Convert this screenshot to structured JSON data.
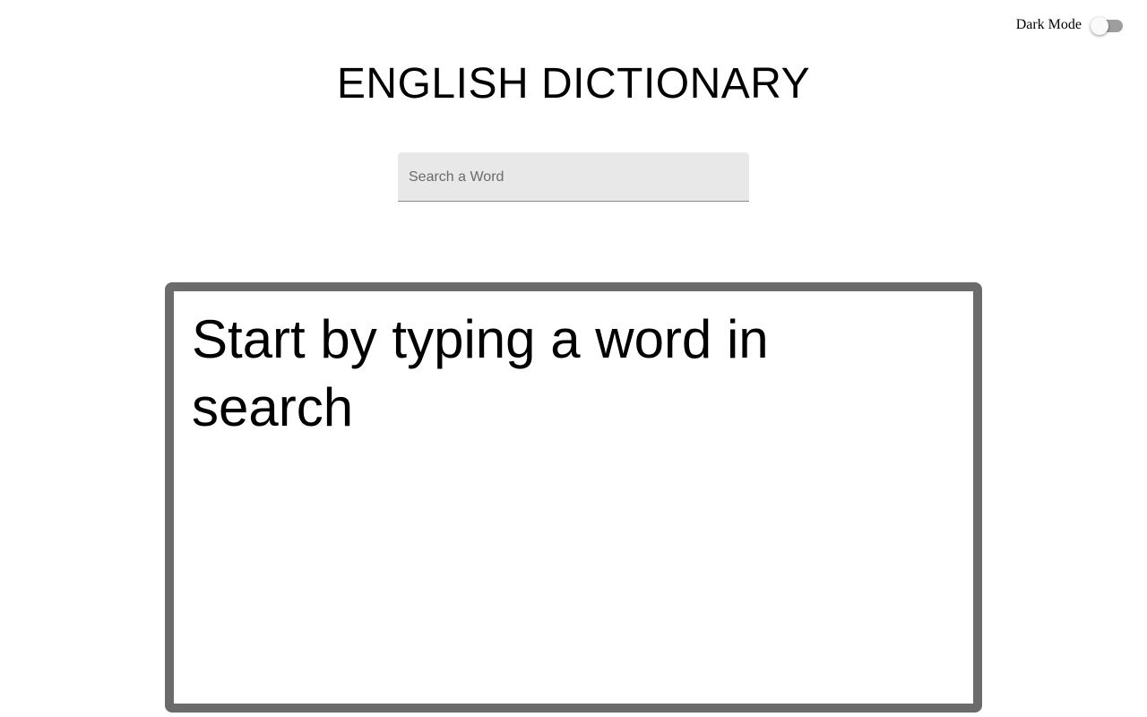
{
  "header": {
    "dark_mode_label": "Dark Mode",
    "dark_mode_enabled": false,
    "title": "ENGLISH DICTIONARY"
  },
  "search": {
    "placeholder": "Search a Word",
    "value": ""
  },
  "result": {
    "message": "Start by typing a word in search"
  },
  "colors": {
    "background": "#ffffff",
    "search_field_bg": "#e8e8e8",
    "result_border": "#6b6b6b",
    "toggle_track": "#9e9e9e",
    "toggle_thumb": "#fafafa"
  }
}
